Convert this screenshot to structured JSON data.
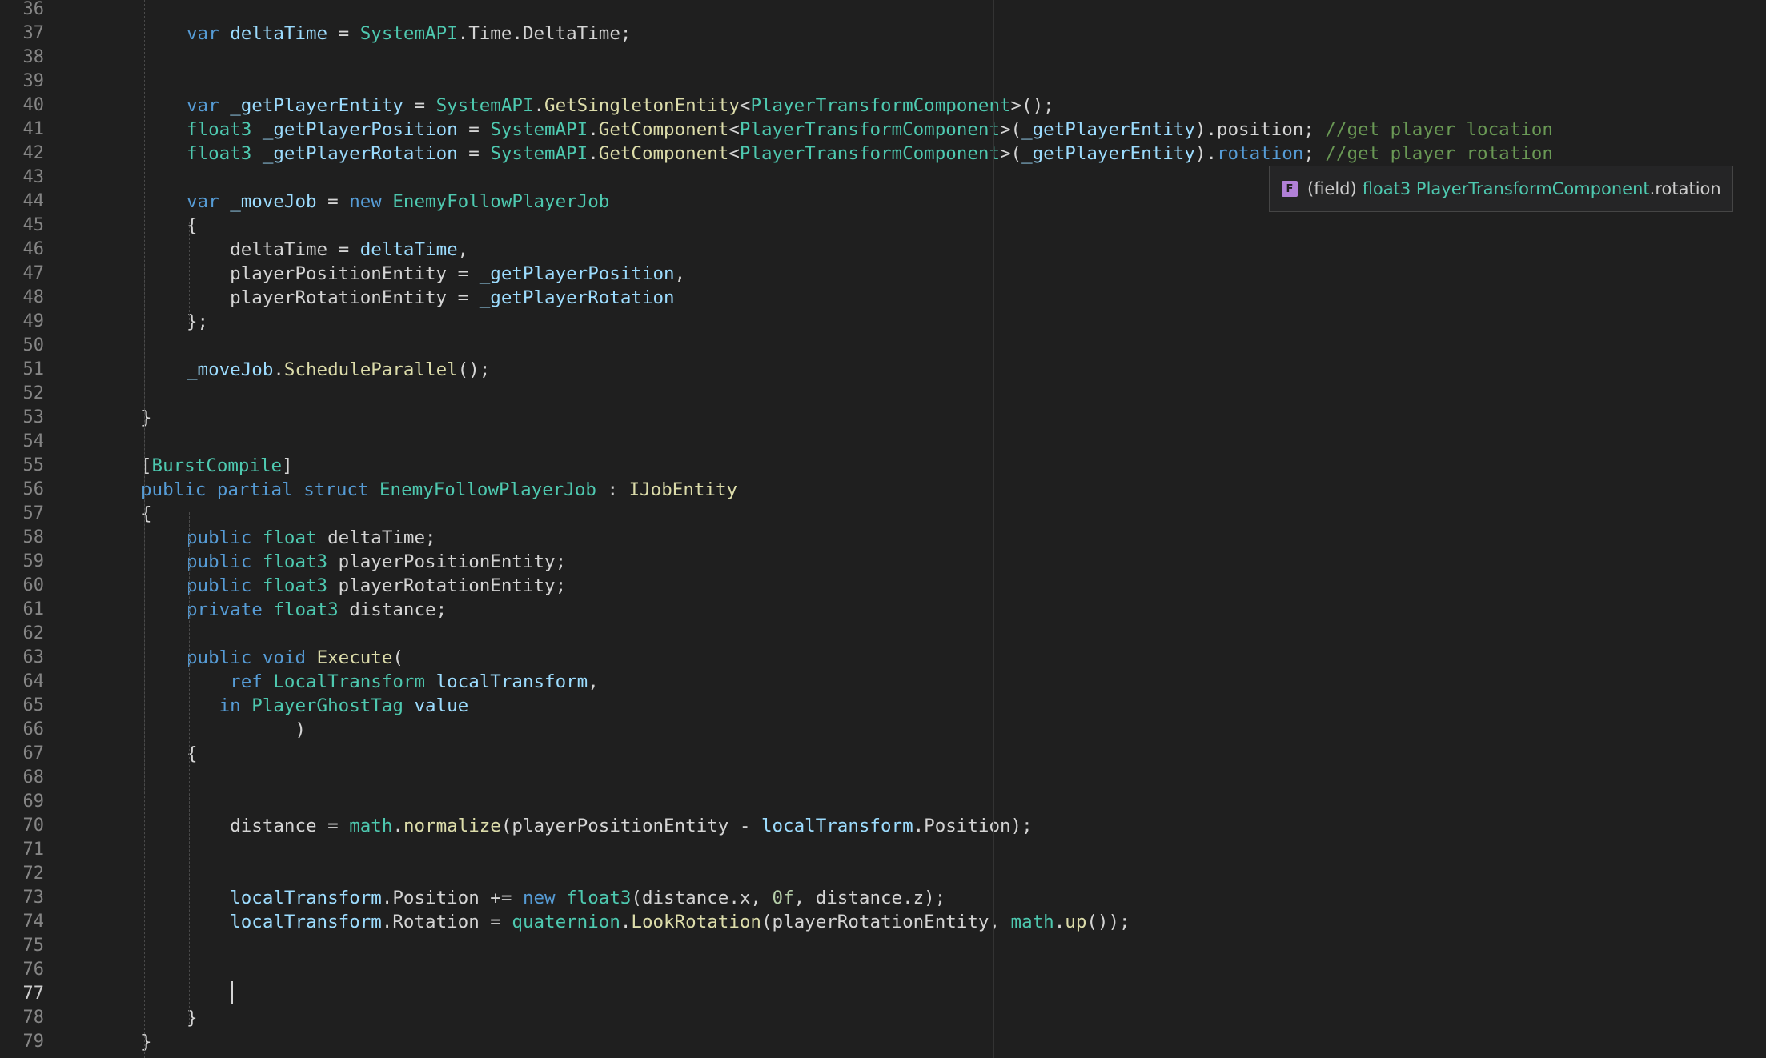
{
  "editor": {
    "language": "csharp",
    "active_line": 77,
    "lines": [
      {
        "n": "36",
        "tokens": []
      },
      {
        "n": "37",
        "tokens": [
          [
            "kw",
            "var "
          ],
          [
            "var",
            "deltaTime"
          ],
          [
            "pl",
            " = "
          ],
          [
            "ty",
            "SystemAPI"
          ],
          [
            "pl",
            ".Time.DeltaTime;"
          ]
        ]
      },
      {
        "n": "38",
        "tokens": []
      },
      {
        "n": "39",
        "tokens": []
      },
      {
        "n": "40",
        "tokens": [
          [
            "kw",
            "var "
          ],
          [
            "var",
            "_getPlayerEntity"
          ],
          [
            "pl",
            " = "
          ],
          [
            "ty",
            "SystemAPI"
          ],
          [
            "pl",
            "."
          ],
          [
            "fn",
            "GetSingletonEntity"
          ],
          [
            "pl",
            "<"
          ],
          [
            "ty",
            "PlayerTransformComponent"
          ],
          [
            "pl",
            ">();"
          ]
        ]
      },
      {
        "n": "41",
        "tokens": [
          [
            "ty",
            "float3"
          ],
          [
            "pl",
            " "
          ],
          [
            "var",
            "_getPlayerPosition"
          ],
          [
            "pl",
            " = "
          ],
          [
            "ty",
            "SystemAPI"
          ],
          [
            "pl",
            "."
          ],
          [
            "fn",
            "GetComponent"
          ],
          [
            "pl",
            "<"
          ],
          [
            "ty",
            "PlayerTransformComponent"
          ],
          [
            "pl",
            ">("
          ],
          [
            "var",
            "_getPlayerEntity"
          ],
          [
            "pl",
            ").position; "
          ],
          [
            "cm",
            "//get player location"
          ]
        ]
      },
      {
        "n": "42",
        "tokens": [
          [
            "ty",
            "float3"
          ],
          [
            "pl",
            " "
          ],
          [
            "var",
            "_getPlayerRotation"
          ],
          [
            "pl",
            " = "
          ],
          [
            "ty",
            "SystemAPI"
          ],
          [
            "pl",
            "."
          ],
          [
            "fn",
            "GetComponent"
          ],
          [
            "pl",
            "<"
          ],
          [
            "ty",
            "PlayerTransformComponent"
          ],
          [
            "pl",
            ">("
          ],
          [
            "var",
            "_getPlayerEntity"
          ],
          [
            "pl",
            ")."
          ],
          [
            "kw",
            "rotation"
          ],
          [
            "pl",
            "; "
          ],
          [
            "cm",
            "//get player rotation"
          ]
        ]
      },
      {
        "n": "43",
        "tokens": []
      },
      {
        "n": "44",
        "tokens": [
          [
            "kw",
            "var "
          ],
          [
            "var",
            "_moveJob"
          ],
          [
            "pl",
            " = "
          ],
          [
            "kw",
            "new "
          ],
          [
            "ty",
            "EnemyFollowPlayerJob"
          ]
        ]
      },
      {
        "n": "45",
        "tokens": [
          [
            "pl",
            "{"
          ]
        ]
      },
      {
        "n": "46",
        "tokens": [
          [
            "pl",
            "    deltaTime = "
          ],
          [
            "var",
            "deltaTime"
          ],
          [
            "pl",
            ","
          ]
        ]
      },
      {
        "n": "47",
        "tokens": [
          [
            "pl",
            "    playerPositionEntity = "
          ],
          [
            "var",
            "_getPlayerPosition"
          ],
          [
            "pl",
            ","
          ]
        ]
      },
      {
        "n": "48",
        "tokens": [
          [
            "pl",
            "    playerRotationEntity = "
          ],
          [
            "var",
            "_getPlayerRotation"
          ]
        ]
      },
      {
        "n": "49",
        "tokens": [
          [
            "pl",
            "};"
          ]
        ]
      },
      {
        "n": "50",
        "tokens": []
      },
      {
        "n": "51",
        "tokens": [
          [
            "var",
            "_moveJob"
          ],
          [
            "pl",
            "."
          ],
          [
            "fn",
            "ScheduleParallel"
          ],
          [
            "pl",
            "();"
          ]
        ]
      },
      {
        "n": "52",
        "tokens": []
      },
      {
        "n": "53",
        "tokens": [
          [
            "pl",
            "}"
          ]
        ]
      },
      {
        "n": "54",
        "tokens": []
      },
      {
        "n": "55",
        "tokens": [
          [
            "pl",
            "["
          ],
          [
            "ty",
            "BurstCompile"
          ],
          [
            "pl",
            "]"
          ]
        ]
      },
      {
        "n": "56",
        "tokens": [
          [
            "kw",
            "public partial struct "
          ],
          [
            "ty",
            "EnemyFollowPlayerJob"
          ],
          [
            "pl",
            " : "
          ],
          [
            "fn",
            "IJobEntity"
          ]
        ]
      },
      {
        "n": "57",
        "tokens": [
          [
            "pl",
            "{"
          ]
        ]
      },
      {
        "n": "58",
        "tokens": [
          [
            "kw",
            "public "
          ],
          [
            "ty",
            "float"
          ],
          [
            "pl",
            " deltaTime;"
          ]
        ]
      },
      {
        "n": "59",
        "tokens": [
          [
            "kw",
            "public "
          ],
          [
            "ty",
            "float3"
          ],
          [
            "pl",
            " playerPositionEntity;"
          ]
        ]
      },
      {
        "n": "60",
        "tokens": [
          [
            "kw",
            "public "
          ],
          [
            "ty",
            "float3"
          ],
          [
            "pl",
            " playerRotationEntity;"
          ]
        ]
      },
      {
        "n": "61",
        "tokens": [
          [
            "kw",
            "private "
          ],
          [
            "ty",
            "float3"
          ],
          [
            "pl",
            " distance;"
          ]
        ]
      },
      {
        "n": "62",
        "tokens": []
      },
      {
        "n": "63",
        "tokens": [
          [
            "kw",
            "public void "
          ],
          [
            "fn",
            "Execute"
          ],
          [
            "pl",
            "("
          ]
        ]
      },
      {
        "n": "64",
        "tokens": [
          [
            "kw",
            "    ref "
          ],
          [
            "ty",
            "LocalTransform"
          ],
          [
            "pl",
            " "
          ],
          [
            "var",
            "localTransform"
          ],
          [
            "pl",
            ","
          ]
        ]
      },
      {
        "n": "65",
        "tokens": [
          [
            "kw",
            "   in "
          ],
          [
            "ty",
            "PlayerGhostTag"
          ],
          [
            "pl",
            " "
          ],
          [
            "var",
            "value"
          ]
        ]
      },
      {
        "n": "66",
        "tokens": [
          [
            "pl",
            "          )"
          ]
        ]
      },
      {
        "n": "67",
        "tokens": [
          [
            "pl",
            "{"
          ]
        ]
      },
      {
        "n": "68",
        "tokens": []
      },
      {
        "n": "69",
        "tokens": []
      },
      {
        "n": "70",
        "tokens": [
          [
            "pl",
            "    distance = "
          ],
          [
            "ty",
            "math"
          ],
          [
            "pl",
            "."
          ],
          [
            "fn",
            "normalize"
          ],
          [
            "pl",
            "(playerPositionEntity - "
          ],
          [
            "var",
            "localTransform"
          ],
          [
            "pl",
            ".Position);"
          ]
        ]
      },
      {
        "n": "71",
        "tokens": []
      },
      {
        "n": "72",
        "tokens": []
      },
      {
        "n": "73",
        "tokens": [
          [
            "pl",
            "    "
          ],
          [
            "var",
            "localTransform"
          ],
          [
            "pl",
            ".Position += "
          ],
          [
            "kw",
            "new "
          ],
          [
            "ty",
            "float3"
          ],
          [
            "pl",
            "(distance.x, "
          ],
          [
            "num",
            "0f"
          ],
          [
            "pl",
            ", distance.z);"
          ]
        ]
      },
      {
        "n": "74",
        "tokens": [
          [
            "pl",
            "    "
          ],
          [
            "var",
            "localTransform"
          ],
          [
            "pl",
            ".Rotation = "
          ],
          [
            "ty",
            "quaternion"
          ],
          [
            "pl",
            "."
          ],
          [
            "fn",
            "LookRotation"
          ],
          [
            "pl",
            "(playerRotationEntity, "
          ],
          [
            "ty",
            "math"
          ],
          [
            "pl",
            "."
          ],
          [
            "fn",
            "up"
          ],
          [
            "pl",
            "());"
          ]
        ]
      },
      {
        "n": "75",
        "tokens": []
      },
      {
        "n": "76",
        "tokens": []
      },
      {
        "n": "77",
        "tokens": []
      },
      {
        "n": "78",
        "tokens": [
          [
            "pl",
            "}"
          ]
        ]
      },
      {
        "n": "79",
        "tokens": [
          [
            "pl",
            "}"
          ]
        ]
      }
    ]
  },
  "hover": {
    "icon": "field-icon",
    "icon_glyph": "F",
    "kind": "(field)",
    "type": "float3 PlayerTransformComponent",
    "member": ".rotation"
  },
  "colors": {
    "background": "#1f1f1f",
    "keyword": "#569cd6",
    "type": "#4ec9b0",
    "function": "#dcdcaa",
    "variable": "#9cdcfe",
    "comment": "#6a9955",
    "number": "#b5cea8"
  }
}
